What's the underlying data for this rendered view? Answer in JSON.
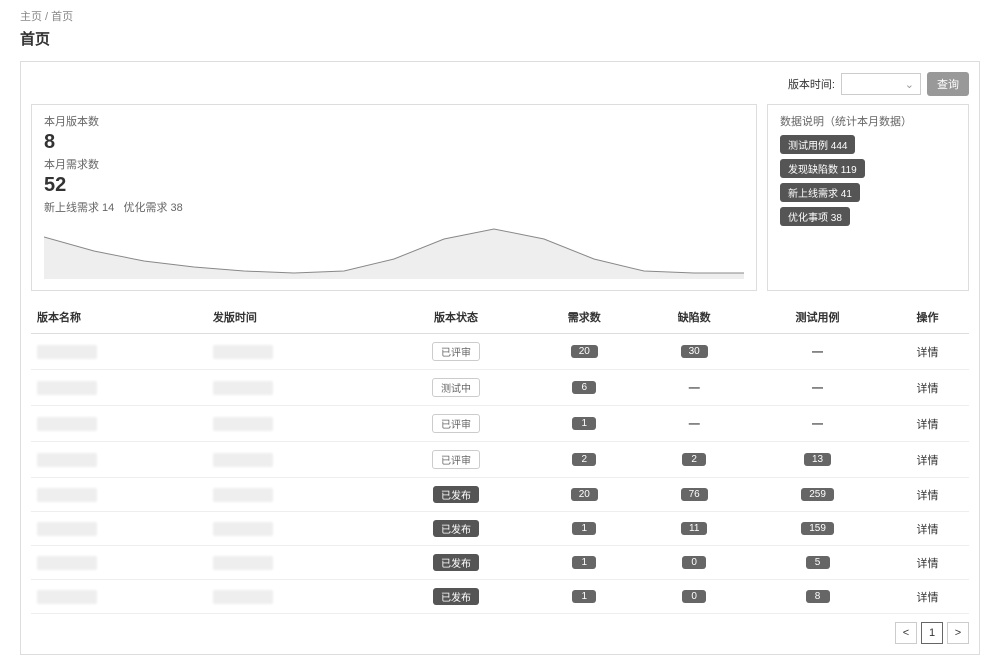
{
  "breadcrumb": {
    "home": "主页",
    "current": "首页"
  },
  "page_title": "首页",
  "filter": {
    "label": "版本时间:",
    "query_btn": "查询"
  },
  "stats": {
    "month_version_label": "本月版本数",
    "month_version_value": "8",
    "month_req_label": "本月需求数",
    "month_req_value": "52",
    "new_online": "新上线需求 14",
    "optimize": "优化需求 38"
  },
  "info": {
    "title": "数据说明（统计本月数据）",
    "pills": [
      "测试用例 444",
      "发现缺陷数 119",
      "新上线需求 41",
      "优化事项 38"
    ]
  },
  "chart_data": {
    "type": "area",
    "x": [
      0,
      50,
      100,
      150,
      200,
      250,
      300,
      350,
      400,
      450,
      500,
      550,
      600,
      650,
      700
    ],
    "y": [
      42,
      28,
      18,
      12,
      8,
      6,
      8,
      20,
      40,
      50,
      40,
      20,
      8,
      6,
      6
    ],
    "ylim": [
      0,
      60
    ]
  },
  "table": {
    "headers": [
      "版本名称",
      "发版时间",
      "版本状态",
      "需求数",
      "缺陷数",
      "测试用例",
      "操作"
    ],
    "action_label": "详情",
    "rows": [
      {
        "status": "已评审",
        "status_style": "light",
        "req": "20",
        "defect": "30",
        "tc": "—"
      },
      {
        "status": "测试中",
        "status_style": "light",
        "req": "6",
        "defect": "—",
        "tc": "—"
      },
      {
        "status": "已评审",
        "status_style": "light",
        "req": "1",
        "defect": "—",
        "tc": "—"
      },
      {
        "status": "已评审",
        "status_style": "light",
        "req": "2",
        "defect": "2",
        "tc": "13"
      },
      {
        "status": "已发布",
        "status_style": "dark",
        "req": "20",
        "defect": "76",
        "tc": "259"
      },
      {
        "status": "已发布",
        "status_style": "dark",
        "req": "1",
        "defect": "11",
        "tc": "159"
      },
      {
        "status": "已发布",
        "status_style": "dark",
        "req": "1",
        "defect": "0",
        "tc": "5"
      },
      {
        "status": "已发布",
        "status_style": "dark",
        "req": "1",
        "defect": "0",
        "tc": "8"
      }
    ]
  },
  "pagination": {
    "prev": "<",
    "current": "1",
    "next": ">"
  }
}
